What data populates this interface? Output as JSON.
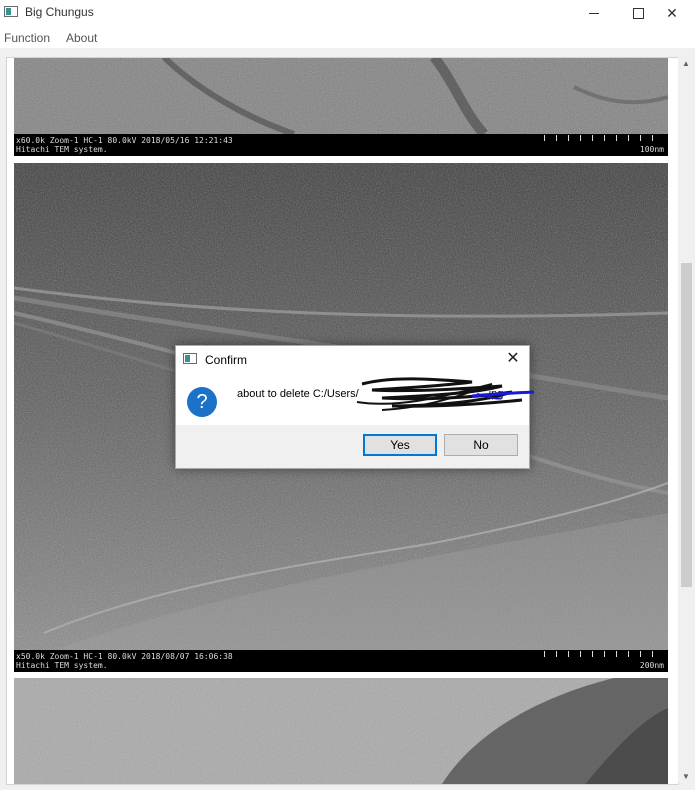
{
  "window": {
    "title": "Big Chungus"
  },
  "menu": {
    "items": [
      "Function",
      "About"
    ]
  },
  "images": [
    {
      "caption_line1": "x60.0k Zoom-1 HC-1 80.0kV 2018/05/16 12:21:43",
      "caption_line2": "Hitachi TEM system.",
      "scale": "100nm"
    },
    {
      "caption_line1": "x50.0k Zoom-1 HC-1 80.0kV 2018/08/07 16:06:38",
      "caption_line2": "Hitachi TEM system.",
      "scale": "200nm"
    }
  ],
  "dialog": {
    "title": "Confirm",
    "message": "about to delete C:/Users/",
    "message_suffix": "jpg",
    "yes_label": "Yes",
    "no_label": "No",
    "icon": "question-icon"
  }
}
